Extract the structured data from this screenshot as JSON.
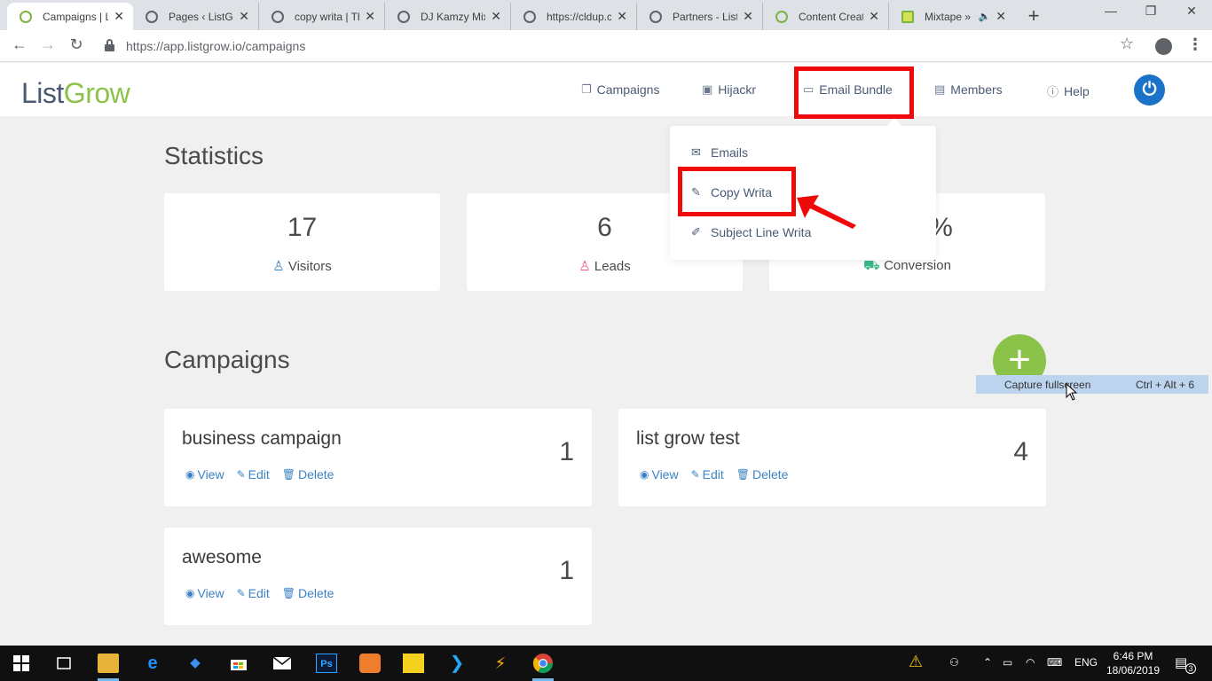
{
  "browser": {
    "tabs": [
      {
        "title": "Campaigns | Li",
        "fav": "green",
        "active": true
      },
      {
        "title": "Pages ‹ ListGro",
        "fav": "globe"
      },
      {
        "title": "copy writa | Th",
        "fav": "globe"
      },
      {
        "title": "DJ Kamzy Mixt",
        "fav": "globe"
      },
      {
        "title": "https://cldup.c",
        "fav": "globe"
      },
      {
        "title": "Partners - ListC",
        "fav": "globe"
      },
      {
        "title": "Content Creati",
        "fav": "green"
      },
      {
        "title": "Mixtape »",
        "fav": "mix"
      }
    ],
    "new_tab": "+",
    "minimize": "—",
    "maximize": "❐",
    "close": "✕",
    "back": "←",
    "forward": "→",
    "reload": "↻",
    "url": "https://app.listgrow.io/campaigns",
    "star": "☆",
    "menu": "⋮",
    "tab_close": "✕",
    "speaker": "🔈"
  },
  "app": {
    "logo_list": "List",
    "logo_grow": "Grow",
    "nav": [
      {
        "label": "Campaigns",
        "icon": "campaigns-icon",
        "glyph": "❐"
      },
      {
        "label": "Hijackr",
        "icon": "camera-icon",
        "glyph": "▣"
      },
      {
        "label": "Email Bundle",
        "icon": "archive-icon",
        "glyph": "▭"
      },
      {
        "label": "Members",
        "icon": "id-card-icon",
        "glyph": "▤"
      },
      {
        "label": "Help",
        "icon": "info-icon",
        "glyph": "ⓘ"
      }
    ],
    "power_glyph": "⏻"
  },
  "dropdown": {
    "items": [
      {
        "label": "Emails",
        "glyph": "✉"
      },
      {
        "label": "Copy Writa",
        "glyph": "✎"
      },
      {
        "label": "Subject Line Writa",
        "glyph": "✐"
      }
    ]
  },
  "statistics": {
    "title": "Statistics",
    "cards": [
      {
        "value": "17",
        "label": "Visitors",
        "glyph": "♙"
      },
      {
        "value": "6",
        "label": "Leads",
        "glyph": "♙"
      },
      {
        "value": "%",
        "label": "Conversion",
        "glyph": "⛟"
      }
    ]
  },
  "campaigns": {
    "title": "Campaigns",
    "add_glyph": "+",
    "view_label": "View",
    "edit_label": "Edit",
    "delete_label": "Delete",
    "view_glyph": "◉",
    "edit_glyph": "✎",
    "delete_glyph": "🗑",
    "items": [
      {
        "name": "business campaign",
        "count": "1"
      },
      {
        "name": "list grow test",
        "count": "4"
      },
      {
        "name": "awesome",
        "count": "1"
      }
    ]
  },
  "capture_tooltip": {
    "label": "Capture fullscreen",
    "shortcut": "Ctrl + Alt + 6"
  },
  "taskbar": {
    "language": "ENG",
    "time": "6:46 PM",
    "date": "18/06/2019",
    "notifications": "3"
  },
  "colors": {
    "brand_green": "#8bc34a",
    "brand_blue": "#1a73c8",
    "link_blue": "#3b82c4",
    "annotation_red": "#ee0a0a"
  }
}
